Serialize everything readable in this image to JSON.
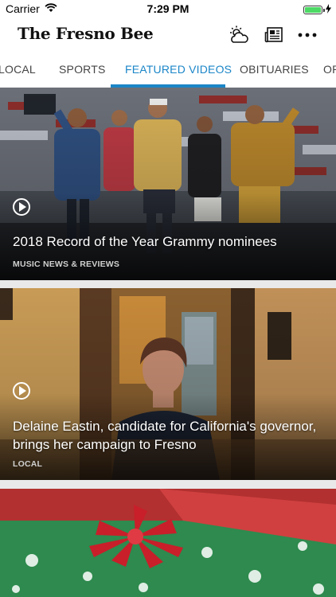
{
  "status_bar": {
    "carrier": "Carrier",
    "time": "7:29 PM"
  },
  "header": {
    "title": "The Fresno Bee",
    "icons": [
      "weather-icon",
      "newspaper-icon",
      "more-icon"
    ]
  },
  "tabs": [
    {
      "label": "LOCAL",
      "active": false
    },
    {
      "label": "SPORTS",
      "active": false
    },
    {
      "label": "FEATURED VIDEOS",
      "active": true
    },
    {
      "label": "OBITUARIES",
      "active": false
    },
    {
      "label": "OP",
      "active": false
    }
  ],
  "cards": [
    {
      "headline": "2018 Record of the Year Grammy nominees",
      "category": "MUSIC NEWS & REVIEWS"
    },
    {
      "headline": "Delaine Eastin, candidate for California's governor, brings her campaign to Fresno",
      "category": "LOCAL"
    },
    {
      "headline": "",
      "category": ""
    }
  ],
  "colors": {
    "accent": "#1b86c8",
    "battery": "#4cd964"
  }
}
